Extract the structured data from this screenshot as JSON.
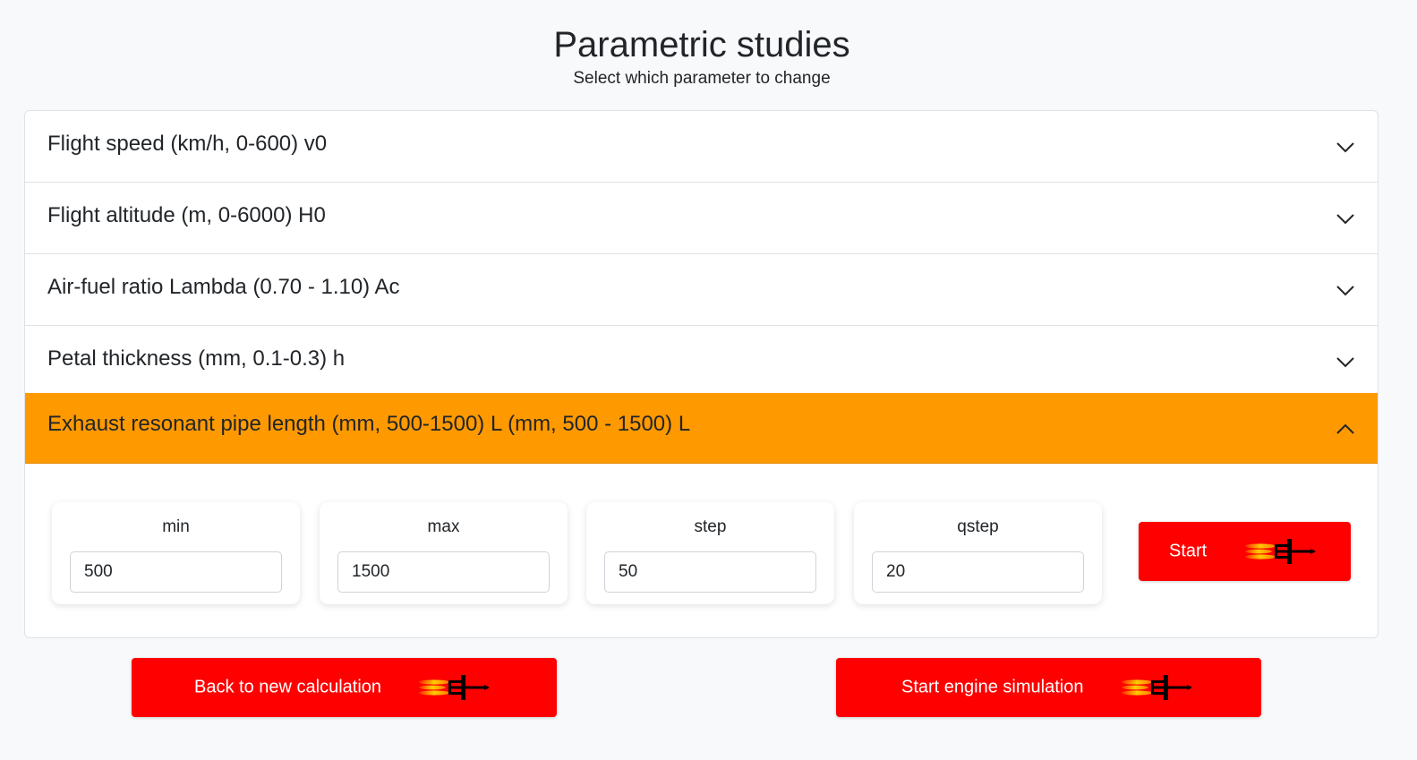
{
  "header": {
    "title": "Parametric studies",
    "subtitle": "Select which parameter to change"
  },
  "accordion": {
    "items": [
      {
        "label": "Flight speed (km/h, 0-600) v0",
        "expanded": false
      },
      {
        "label": "Flight altitude (m, 0-6000) H0",
        "expanded": false
      },
      {
        "label": "Air-fuel ratio Lambda (0.70 - 1.10) Ac",
        "expanded": false
      },
      {
        "label": "Petal thickness (mm, 0.1-0.3) h",
        "expanded": false
      },
      {
        "label": "Exhaust resonant pipe length (mm, 500-1500) L (mm, 500 - 1500) L",
        "expanded": true
      }
    ],
    "active_color": "#ff9900"
  },
  "params": {
    "min": {
      "label": "min",
      "value": "500"
    },
    "max": {
      "label": "max",
      "value": "1500"
    },
    "step": {
      "label": "step",
      "value": "50"
    },
    "qstep": {
      "label": "qstep",
      "value": "20"
    }
  },
  "buttons": {
    "start": "Start",
    "back": "Back to new calculation",
    "simulate": "Start engine simulation",
    "color": "#ff0000",
    "icon": "rocket-icon"
  }
}
